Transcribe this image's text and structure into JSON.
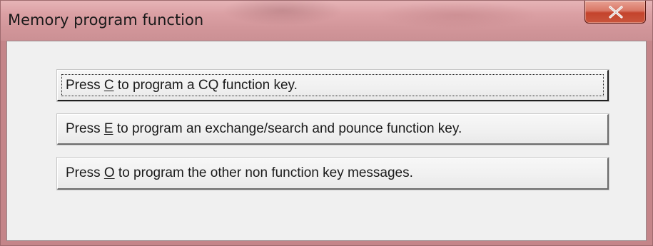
{
  "window": {
    "title": "Memory program function",
    "close_glyph": "X"
  },
  "buttons": [
    {
      "prefix": "Press ",
      "hotkey": "C",
      "suffix": " to program a CQ function key.",
      "focused": true
    },
    {
      "prefix": "Press ",
      "hotkey": "E",
      "suffix": " to program an exchange/search and pounce function key.",
      "focused": false
    },
    {
      "prefix": "Press ",
      "hotkey": "O",
      "suffix": " to program the other non function key messages.",
      "focused": false
    }
  ],
  "icons": {
    "close": "close-icon"
  }
}
